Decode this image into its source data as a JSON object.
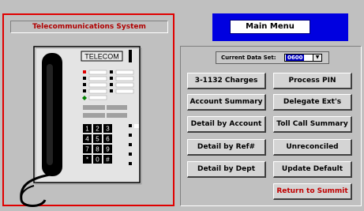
{
  "left_panel": {
    "title": "Telecommunications System",
    "phone_label": "TELECOM",
    "keypad": [
      "1",
      "2",
      "3",
      "4",
      "5",
      "6",
      "7",
      "8",
      "9",
      "*",
      "0",
      "#"
    ]
  },
  "main_menu_label": "Main Menu",
  "dataset": {
    "label": "Current Data Set:",
    "value": "0600"
  },
  "buttons": {
    "charges": "3-1132 Charges",
    "process_pin": "Process PIN",
    "account_summary": "Account Summary",
    "delegate_exts": "Delegate Ext's",
    "detail_by_account": "Detail by Account",
    "toll_call_summary": "Toll Call Summary",
    "detail_by_ref": "Detail by Ref#",
    "unreconciled": "Unreconciled",
    "detail_by_dept": "Detail by Dept",
    "update_default": "Update Default",
    "return_to_summit": "Return to Summit"
  },
  "colors": {
    "background": "#c0c0c0",
    "panel_border": "#e00000",
    "title_text": "#b00000",
    "main_menu_bg": "#0000e0",
    "return_text": "#c00000"
  }
}
